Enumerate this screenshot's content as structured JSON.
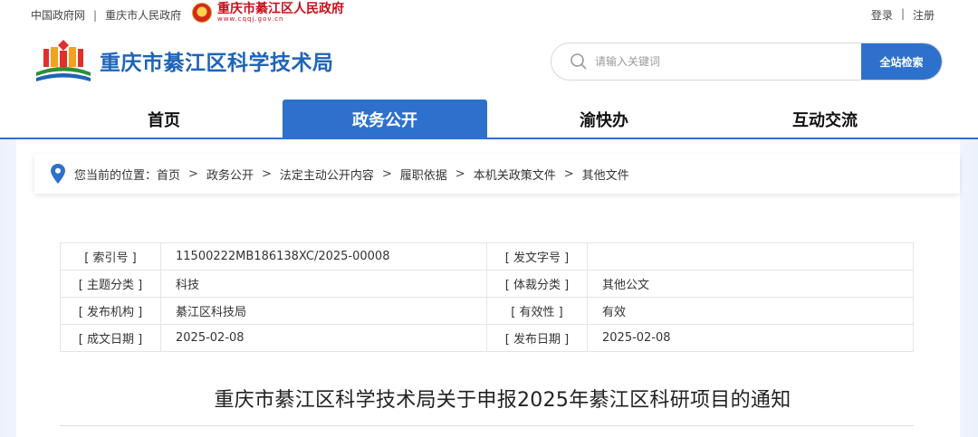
{
  "topbar": {
    "links": [
      "中国政府网",
      "重庆市人民政府"
    ],
    "separator": "|",
    "gov_name": "重庆市綦江区人民政府",
    "gov_url": "www.cqqj.gov.cn",
    "login": "登录",
    "register": "注册"
  },
  "header": {
    "site_title": "重庆市綦江区科学技术局",
    "search_placeholder": "请输入关键词",
    "search_button": "全站检索"
  },
  "nav": {
    "items": [
      "首页",
      "政务公开",
      "渝快办",
      "互动交流"
    ],
    "active": "政务公开"
  },
  "breadcrumb": {
    "lead": "您当前的位置：",
    "items": [
      "首页",
      "政务公开",
      "法定主动公开内容",
      "履职依据",
      "本机关政策文件",
      "其他文件"
    ],
    "arrow": ">"
  },
  "info": {
    "rows": [
      {
        "k1": "[ 索引号 ]",
        "v1": "11500222MB186138XC/2025-00008",
        "k2": "[ 发文字号 ]",
        "v2": ""
      },
      {
        "k1": "[ 主题分类 ]",
        "v1": "科技",
        "k2": "[ 体裁分类 ]",
        "v2": "其他公文"
      },
      {
        "k1": "[ 发布机构 ]",
        "v1": "綦江区科技局",
        "k2": "[ 有效性 ]",
        "v2": "有效"
      },
      {
        "k1": "[ 成文日期 ]",
        "v1": "2025-02-08",
        "k2": "[ 发布日期 ]",
        "v2": "2025-02-08"
      }
    ]
  },
  "document": {
    "title": "重庆市綦江区科学技术局关于申报2025年綦江区科研项目的通知"
  },
  "colors": {
    "primary": "#2e71cc",
    "title_blue": "#1f64b8",
    "gov_red": "#c8101c"
  }
}
